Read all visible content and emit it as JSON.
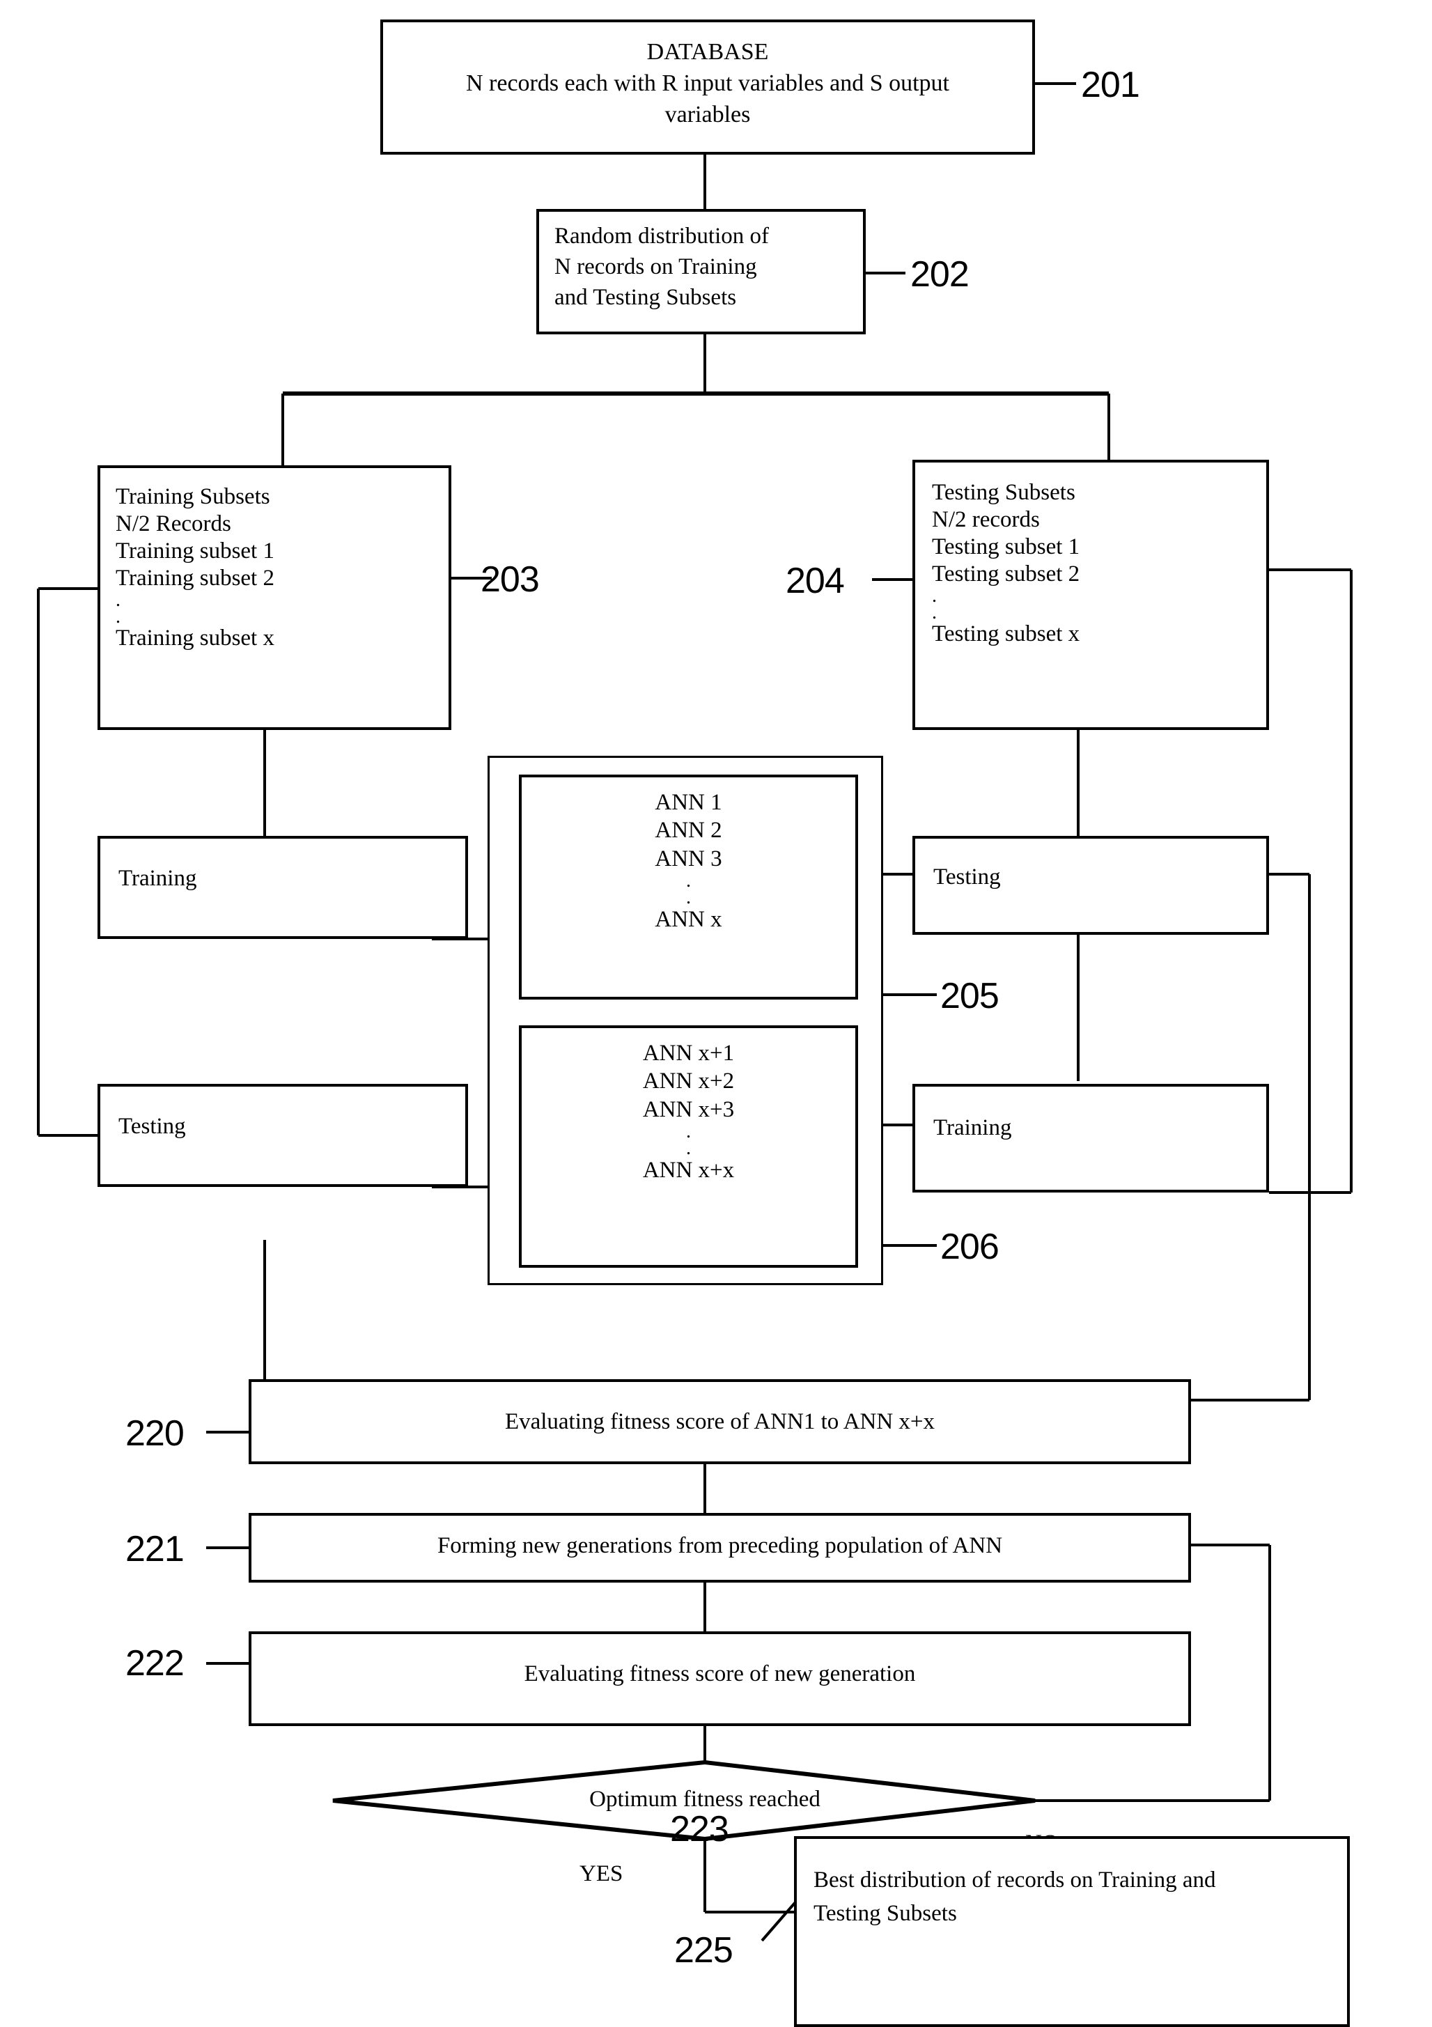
{
  "figure": {
    "type": "patent-flowchart",
    "background_color": "#ffffff",
    "line_color": "#000000"
  },
  "nodes": {
    "database": {
      "ref": "201",
      "lines": [
        "DATABASE",
        "N records each with R input variables and S output",
        "variables"
      ]
    },
    "random_distribution": {
      "ref": "202",
      "lines": [
        "Random distribution of",
        "N records on Training",
        "and Testing Subsets"
      ]
    },
    "training_subsets": {
      "ref": "203",
      "lines": [
        "Training Subsets",
        "N/2 Records",
        "Training subset 1",
        "Training subset 2",
        ".",
        ".",
        "Training subset x"
      ]
    },
    "testing_subsets": {
      "ref": "204",
      "lines": [
        "Testing Subsets",
        "N/2 records",
        "Testing subset 1",
        "Testing subset 2",
        ".",
        ".",
        "Testing subset x"
      ]
    },
    "ann_group_1": {
      "ref": "205",
      "lines": [
        "ANN 1",
        "ANN 2",
        "ANN 3",
        ".",
        ".",
        "ANN x"
      ]
    },
    "ann_group_2": {
      "ref": "206",
      "lines": [
        "ANN x+1",
        "ANN x+2",
        "ANN x+3",
        ".",
        ".",
        "ANN x+x"
      ]
    },
    "left_training": {
      "label": "Training"
    },
    "left_testing": {
      "label": "Testing"
    },
    "right_testing": {
      "label": "Testing"
    },
    "right_training": {
      "label": "Training"
    },
    "evaluate_fitness": {
      "ref": "220",
      "label": "Evaluating fitness score of ANN1 to ANN x+x"
    },
    "form_generations": {
      "ref": "221",
      "label": "Forming new generations from preceding population of ANN"
    },
    "evaluate_new_generation": {
      "ref": "222",
      "label": "Evaluating fitness score of new generation"
    },
    "decision": {
      "ref": "223",
      "label": "Optimum fitness reached"
    },
    "best_distribution": {
      "ref": "225",
      "lines": [
        "Best distribution of records on Training and",
        "Testing Subsets"
      ]
    }
  },
  "edge_labels": {
    "yes": "YES",
    "no": "NO"
  }
}
